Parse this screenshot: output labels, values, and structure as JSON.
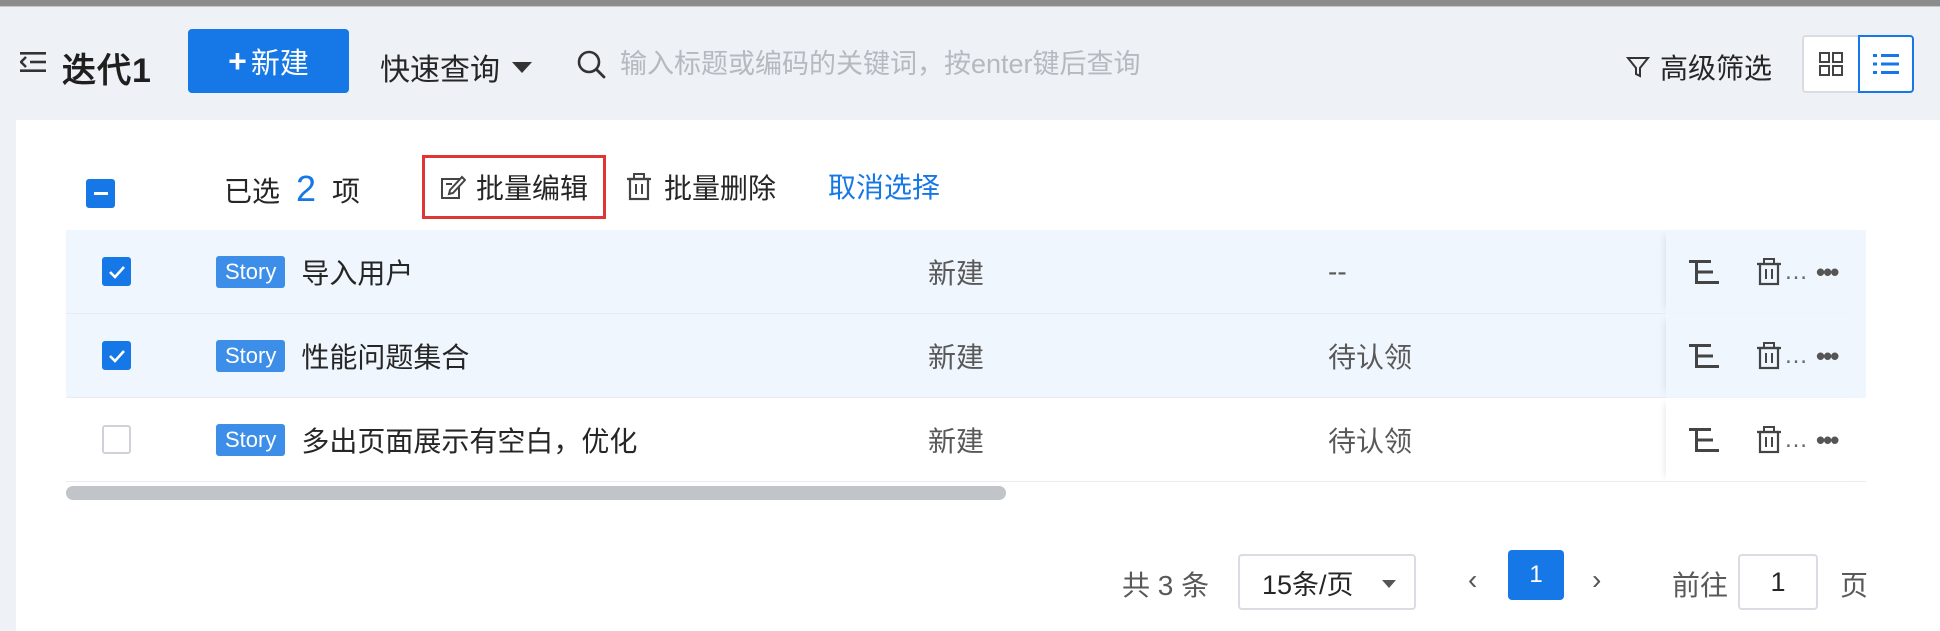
{
  "header": {
    "title": "迭代1",
    "new_button": "新建",
    "quick_query": "快速查询",
    "search_placeholder": "输入标题或编码的关键词，按enter键后查询",
    "advanced_filter": "高级筛选"
  },
  "bulk": {
    "selected_prefix": "已选",
    "selected_count": "2",
    "selected_suffix": "项",
    "bulk_edit": "批量编辑",
    "bulk_delete": "批量删除",
    "cancel_selection": "取消选择"
  },
  "rows": [
    {
      "checked": true,
      "tag": "Story",
      "title": "导入用户",
      "status": "新建",
      "owner": "--",
      "ellipsis": "…"
    },
    {
      "checked": true,
      "tag": "Story",
      "title": "性能问题集合",
      "status": "新建",
      "owner": "待认领",
      "ellipsis": "…"
    },
    {
      "checked": false,
      "tag": "Story",
      "title": "多出页面展示有空白，优化",
      "status": "新建",
      "owner": "待认领",
      "ellipsis": "…"
    }
  ],
  "pagination": {
    "total": "共 3 条",
    "page_size": "15条/页",
    "current_page": "1",
    "goto_label": "前往",
    "goto_value": "1",
    "page_unit": "页"
  },
  "colors": {
    "accent": "#1677e6",
    "selected_row": "#f0f6fe",
    "tag": "#3c8ee8",
    "highlight_border": "#e03535"
  }
}
